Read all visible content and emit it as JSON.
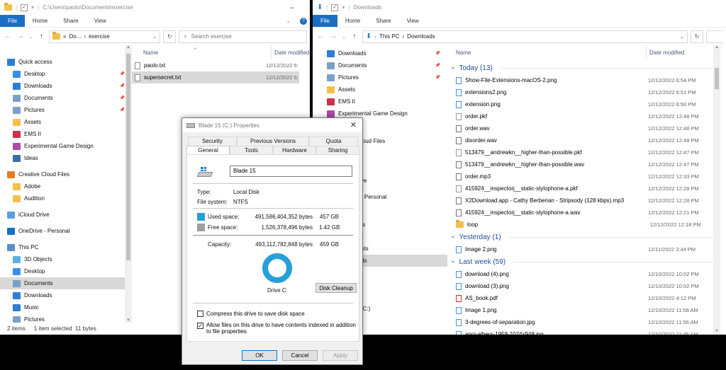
{
  "left_window": {
    "title": "C:\\Users\\paolo\\Documents\\exercise",
    "ribbon": {
      "file": "File",
      "home": "Home",
      "share": "Share",
      "view": "View"
    },
    "breadcrumb": {
      "chevrons": "«",
      "part1": "Do...",
      "sep": "›",
      "part2": "exercise"
    },
    "search_placeholder": "Search exercise",
    "nav": [
      {
        "label": "Quick access",
        "icon": "star-icon",
        "color": "#2b7fd6"
      },
      {
        "label": "Desktop",
        "icon": "desktop-folder-icon",
        "color": "#3a8ee6",
        "pinned": true
      },
      {
        "label": "Downloads",
        "icon": "downloads-folder-icon",
        "color": "#2b7fd6",
        "pinned": true
      },
      {
        "label": "Documents",
        "icon": "documents-folder-icon",
        "color": "#7aa0c8",
        "pinned": true
      },
      {
        "label": "Pictures",
        "icon": "pictures-folder-icon",
        "color": "#7aa0c8",
        "pinned": true
      },
      {
        "label": "Assets",
        "icon": "folder-icon",
        "color": "#f3c14a"
      },
      {
        "label": "EMS II",
        "icon": "app-icon",
        "color": "#c8324a"
      },
      {
        "label": "Experimental Game Design",
        "icon": "app-icon",
        "color": "#b04aa8"
      },
      {
        "label": "Ideas",
        "icon": "bulb-icon",
        "color": "#3a6ea8"
      },
      {
        "label": "Creative Cloud Files",
        "icon": "creative-cloud-icon",
        "color": "#e87a2a"
      },
      {
        "label": "Adobe",
        "icon": "folder-icon",
        "color": "#f3c14a"
      },
      {
        "label": "Audition",
        "icon": "folder-icon",
        "color": "#f3c14a"
      },
      {
        "label": "iCloud Drive",
        "icon": "icloud-icon",
        "color": "#5aa0e0"
      },
      {
        "label": "OneDrive - Personal",
        "icon": "onedrive-icon",
        "color": "#1a6fc4"
      },
      {
        "label": "This PC",
        "icon": "computer-icon",
        "color": "#5a8ec8"
      },
      {
        "label": "3D Objects",
        "icon": "3d-objects-icon",
        "color": "#5ab0e0"
      },
      {
        "label": "Desktop",
        "icon": "desktop-folder-icon",
        "color": "#3a8ee6"
      },
      {
        "label": "Documents",
        "icon": "documents-folder-icon",
        "color": "#7aa0c8",
        "selected": true
      },
      {
        "label": "Downloads",
        "icon": "downloads-folder-icon",
        "color": "#2b7fd6"
      },
      {
        "label": "Music",
        "icon": "music-icon",
        "color": "#2b7fd6"
      },
      {
        "label": "Pictures",
        "icon": "pictures-folder-icon",
        "color": "#7aa0c8"
      }
    ],
    "columns": {
      "name": "Name",
      "date": "Date modified"
    },
    "files": [
      {
        "name": "paolo.txt",
        "date": "12/12/2022 6:"
      },
      {
        "name": "supersecret.txt",
        "date": "12/12/2022 6:",
        "selected": true
      }
    ],
    "status": {
      "items": "2 items",
      "selected": "1 item selected  11 bytes"
    }
  },
  "right_window": {
    "title": "Downloads",
    "ribbon": {
      "file": "File",
      "home": "Home",
      "share": "Share",
      "view": "View"
    },
    "breadcrumb": {
      "part1": "This PC",
      "sep": "›",
      "part2": "Downloads"
    },
    "nav_visible": [
      {
        "label": "Downloads",
        "icon": "downloads-folder-icon",
        "color": "#2b7fd6",
        "pinned": true
      },
      {
        "label": "Documents",
        "icon": "documents-folder-icon",
        "color": "#7aa0c8",
        "pinned": true
      },
      {
        "label": "Pictures",
        "icon": "pictures-folder-icon",
        "color": "#7aa0c8",
        "pinned": true
      },
      {
        "label": "Assets",
        "icon": "folder-icon",
        "color": "#f3c14a"
      },
      {
        "label": "EMS II",
        "icon": "app-icon",
        "color": "#c8324a"
      },
      {
        "label": "Experimental Game Design",
        "icon": "app-icon",
        "color": "#b04aa8"
      }
    ],
    "nav_partial": [
      {
        "label": "loud Files",
        "offset": 199
      },
      {
        "label": "ve",
        "offset": 255
      },
      {
        "label": "- Personal",
        "offset": 278
      },
      {
        "label": "ts",
        "offset": 317
      },
      {
        "label": "nts",
        "offset": 351
      },
      {
        "label": "ds",
        "offset": 368,
        "selected": true
      },
      {
        "label": "(C:)",
        "offset": 436
      }
    ],
    "columns": {
      "name": "Name",
      "date": "Date modified"
    },
    "groups": [
      {
        "title": "Today (13)",
        "files": [
          {
            "name": "Show-File-Extensions-macOS-2.png",
            "date": "12/12/2022 6:54 PM",
            "icon": "image-file-icon"
          },
          {
            "name": "extensions2.png",
            "date": "12/12/2022 6:51 PM",
            "icon": "image-file-icon"
          },
          {
            "name": "extension.png",
            "date": "12/12/2022 6:50 PM",
            "icon": "image-file-icon"
          },
          {
            "name": "order.pkf",
            "date": "12/12/2022 12:48 PM",
            "icon": "file-icon"
          },
          {
            "name": "order.wav",
            "date": "12/12/2022 12:48 PM",
            "icon": "audio-file-icon"
          },
          {
            "name": "disorder.wav",
            "date": "12/12/2022 12:48 PM",
            "icon": "audio-file-icon"
          },
          {
            "name": "513479__andrewkn__higher-than-possible.pkf",
            "date": "12/12/2022 12:47 PM",
            "icon": "file-icon"
          },
          {
            "name": "513479__andrewkn__higher-than-possible.wav",
            "date": "12/12/2022 12:47 PM",
            "icon": "audio-file-icon"
          },
          {
            "name": "order.mp3",
            "date": "12/12/2022 12:33 PM",
            "icon": "audio-file-icon"
          },
          {
            "name": "415924__inspectorj__static-stylophone-a.pkf",
            "date": "12/12/2022 12:28 PM",
            "icon": "file-icon"
          },
          {
            "name": "X2Download.app - Cathy Berberian  - Stripsody (128 kbps).mp3",
            "date": "12/12/2022 12:28 PM",
            "icon": "audio-file-icon"
          },
          {
            "name": "415924__inspectorj__static-stylophone-a.wav",
            "date": "12/12/2022 12:21 PM",
            "icon": "audio-file-icon"
          },
          {
            "name": "loop",
            "date": "12/12/2022 12:18 PM",
            "icon": "folder-icon"
          }
        ]
      },
      {
        "title": "Yesterday (1)",
        "files": [
          {
            "name": "Image 2.png",
            "date": "12/11/2022 3:44 PM",
            "icon": "image-file-icon"
          }
        ]
      },
      {
        "title": "Last week (59)",
        "files": [
          {
            "name": "download (4).png",
            "date": "12/10/2022 10:02 PM",
            "icon": "image-file-icon"
          },
          {
            "name": "download (3).png",
            "date": "12/10/2022 10:02 PM",
            "icon": "image-file-icon"
          },
          {
            "name": "AS_book.pdf",
            "date": "12/10/2022 4:12 PM",
            "icon": "pdf-file-icon"
          },
          {
            "name": "Image 1.png",
            "date": "12/10/2022 11:58 AM",
            "icon": "image-file-icon"
          },
          {
            "name": "3-degrees-of-separation.jpg",
            "date": "12/10/2022 11:56 AM",
            "icon": "image-file-icon"
          },
          {
            "name": "anni-albers-1958-1024x948.jpg",
            "date": "12/10/2022 11:45 AM",
            "icon": "image-file-icon"
          }
        ]
      }
    ]
  },
  "dialog": {
    "title": "Blade 15 (C:) Properties",
    "tabs_row1": [
      "Security",
      "Previous Versions",
      "Quota"
    ],
    "tabs_row2": [
      "General",
      "Tools",
      "Hardware",
      "Sharing"
    ],
    "drive_name": "Blade 15",
    "type_label": "Type:",
    "type_value": "Local Disk",
    "fs_label": "File system:",
    "fs_value": "NTFS",
    "used_label": "Used space:",
    "used_bytes": "491,586,404,352 bytes",
    "used_gb": "457 GB",
    "free_label": "Free space:",
    "free_bytes": "1,526,378,496 bytes",
    "free_gb": "1.42 GB",
    "capacity_label": "Capacity:",
    "capacity_bytes": "493,112,782,848 bytes",
    "capacity_gb": "459 GB",
    "drive_label": "Drive C:",
    "cleanup_button": "Disk Cleanup",
    "compress_label": "Compress this drive to save disk space",
    "compress_checked": false,
    "index_label": "Allow files on this drive to have contents indexed in addition to file properties",
    "index_checked": true,
    "used_fraction": 0.9969,
    "colors": {
      "used": "#26a0da",
      "free": "#a0a0a0"
    },
    "ok": "OK",
    "cancel": "Cancel",
    "apply": "Apply",
    "close_glyph": "✕"
  }
}
